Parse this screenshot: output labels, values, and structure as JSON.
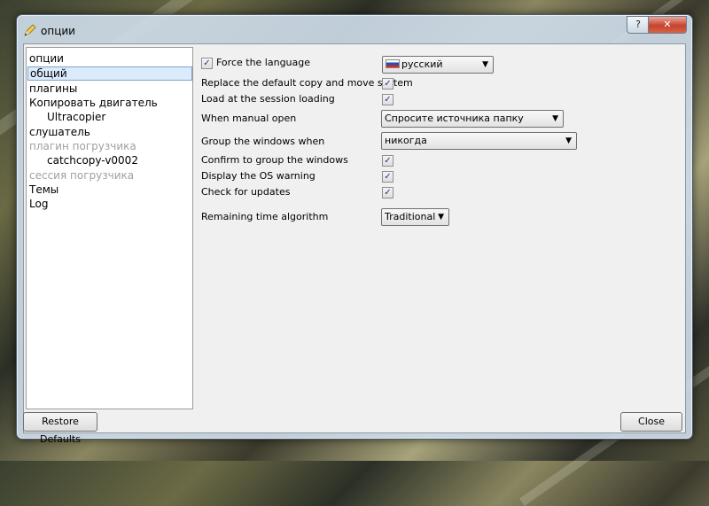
{
  "window": {
    "title": "опции"
  },
  "sidebar": {
    "header": "опции",
    "items": [
      {
        "label": "общий",
        "selected": true,
        "child": false,
        "disabled": false
      },
      {
        "label": "плагины",
        "selected": false,
        "child": false,
        "disabled": false
      },
      {
        "label": "Копировать двигатель",
        "selected": false,
        "child": false,
        "disabled": false
      },
      {
        "label": "Ultracopier",
        "selected": false,
        "child": true,
        "disabled": false
      },
      {
        "label": "слушатель",
        "selected": false,
        "child": false,
        "disabled": false
      },
      {
        "label": "плагин погрузчика",
        "selected": false,
        "child": false,
        "disabled": true
      },
      {
        "label": "catchcopy-v0002",
        "selected": false,
        "child": true,
        "disabled": false
      },
      {
        "label": "сессия погрузчика",
        "selected": false,
        "child": false,
        "disabled": true
      },
      {
        "label": "Темы",
        "selected": false,
        "child": false,
        "disabled": false
      },
      {
        "label": "Log",
        "selected": false,
        "child": false,
        "disabled": false
      }
    ]
  },
  "settings": {
    "force_language": {
      "label": "Force the language",
      "checked": true,
      "value": "русский",
      "flag": "russia-flag-icon"
    },
    "replace_default": {
      "label": "Replace the default copy and move system",
      "checked": true
    },
    "load_session": {
      "label": "Load at the session loading",
      "checked": true
    },
    "manual_open": {
      "label": "When manual open",
      "value": "Спросите источника папку"
    },
    "group_windows": {
      "label": "Group the windows when",
      "value": "никогда"
    },
    "confirm_group": {
      "label": "Confirm to group the windows",
      "checked": true
    },
    "os_warning": {
      "label": "Display the OS warning",
      "checked": true
    },
    "check_updates": {
      "label": "Check for updates",
      "checked": true
    },
    "remaining_time": {
      "label": "Remaining time algorithm",
      "value": "Traditional"
    }
  },
  "buttons": {
    "restore": "Restore Defaults",
    "close": "Close"
  },
  "glyphs": {
    "check": "✓",
    "arrow": "▼",
    "help": "?",
    "close": "✕"
  }
}
